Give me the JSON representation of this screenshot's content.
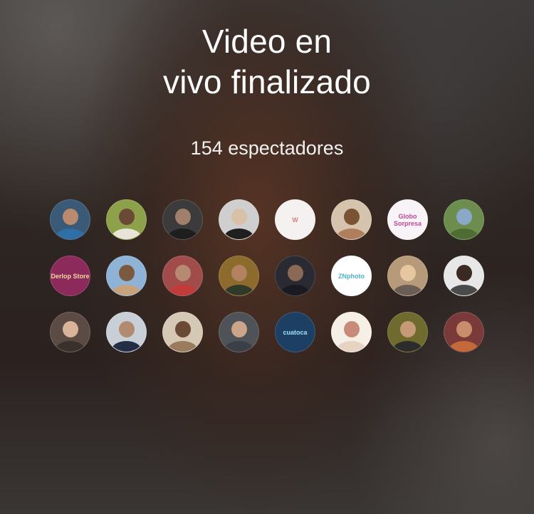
{
  "live_ended": {
    "title_line1": "Video en",
    "title_line2": "vivo finalizado",
    "viewers_text": "154 espectadores"
  },
  "viewer_avatars": [
    {
      "name": "avatar-1",
      "bg": "#3a5a78",
      "fg": "#b98a6d",
      "acc": "#2f6fa8",
      "label": ""
    },
    {
      "name": "avatar-2",
      "bg": "#8da14a",
      "fg": "#6b4a35",
      "acc": "#e9e4da",
      "label": ""
    },
    {
      "name": "avatar-3",
      "bg": "#3b3b3b",
      "fg": "#a07f6c",
      "acc": "#1e1e1e",
      "label": ""
    },
    {
      "name": "avatar-4",
      "bg": "#cfcfcf",
      "fg": "#d9c1a8",
      "acc": "#1f1f1f",
      "label": ""
    },
    {
      "name": "avatar-5",
      "bg": "#f4f1f0",
      "fg": "#f4f1f0",
      "acc": "#f4f1f0",
      "label": "W",
      "color": "#d98080"
    },
    {
      "name": "avatar-6",
      "bg": "#d6c3ad",
      "fg": "#7a5234",
      "acc": "#b07d5d",
      "label": ""
    },
    {
      "name": "avatar-7",
      "bg": "#f7f3f7",
      "fg": "#f7f3f7",
      "acc": "#f7f3f7",
      "label": "Globo Sorpresa",
      "color": "#c1489a"
    },
    {
      "name": "avatar-8",
      "bg": "#6d8d4f",
      "fg": "#8aa8c7",
      "acc": "#4d6d35",
      "label": ""
    },
    {
      "name": "avatar-9",
      "bg": "#8d2a5c",
      "fg": "#8d2a5c",
      "acc": "#8d2a5c",
      "label": "Derlop Store",
      "color": "#f1d9a0"
    },
    {
      "name": "avatar-10",
      "bg": "#8fb3d6",
      "fg": "#7a5a3f",
      "acc": "#c8a27a",
      "label": ""
    },
    {
      "name": "avatar-11",
      "bg": "#a14b4b",
      "fg": "#b68a70",
      "acc": "#c23b3b",
      "label": ""
    },
    {
      "name": "avatar-12",
      "bg": "#8c6b2c",
      "fg": "#b58163",
      "acc": "#2f3a2a",
      "label": ""
    },
    {
      "name": "avatar-13",
      "bg": "#2a2a33",
      "fg": "#8b6a55",
      "acc": "#1a1a22",
      "label": ""
    },
    {
      "name": "avatar-14",
      "bg": "#ffffff",
      "fg": "#ffffff",
      "acc": "#ffffff",
      "label": "ZNphoto",
      "color": "#4fb0cc"
    },
    {
      "name": "avatar-15",
      "bg": "#b79a7a",
      "fg": "#e7c7a1",
      "acc": "#6a5d55",
      "label": ""
    },
    {
      "name": "avatar-16",
      "bg": "#e7e7e7",
      "fg": "#3b2a22",
      "acc": "#4a4a4a",
      "label": ""
    },
    {
      "name": "avatar-17",
      "bg": "#5c4a44",
      "fg": "#d8b49a",
      "acc": "#3a302c",
      "label": ""
    },
    {
      "name": "avatar-18",
      "bg": "#c9cfd7",
      "fg": "#b28a70",
      "acc": "#232d46",
      "label": ""
    },
    {
      "name": "avatar-19",
      "bg": "#d5c8b4",
      "fg": "#6a4a36",
      "acc": "#9b7b5e",
      "label": ""
    },
    {
      "name": "avatar-20",
      "bg": "#4f5257",
      "fg": "#caa58a",
      "acc": "#3a3f48",
      "label": ""
    },
    {
      "name": "avatar-21",
      "bg": "#1d3f63",
      "fg": "#1d3f63",
      "acc": "#1d3f63",
      "label": "cuatoca",
      "color": "#9fe0ff"
    },
    {
      "name": "avatar-22",
      "bg": "#f5efe6",
      "fg": "#c88b7a",
      "acc": "#e6d3c2",
      "label": ""
    },
    {
      "name": "avatar-23",
      "bg": "#6f6a2e",
      "fg": "#c79a77",
      "acc": "#2c2c2c",
      "label": ""
    },
    {
      "name": "avatar-24",
      "bg": "#7a3a3a",
      "fg": "#c88d6a",
      "acc": "#c46a3a",
      "label": ""
    }
  ]
}
